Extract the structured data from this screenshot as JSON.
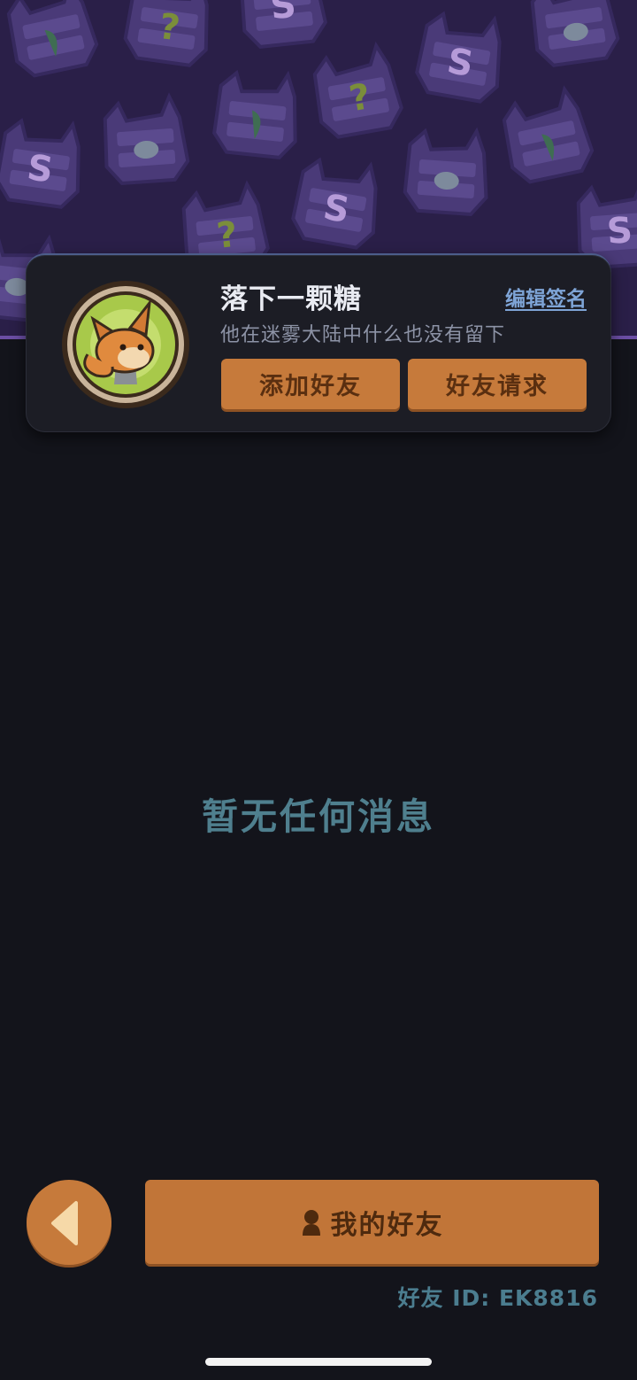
{
  "profile": {
    "nickname": "落下一颗糖",
    "edit_signature_label": "编辑签名",
    "signature": "他在迷雾大陆中什么也没有留下",
    "add_friend_label": "添加好友",
    "friend_request_label": "好友请求"
  },
  "messages": {
    "empty_text": "暂无任何消息"
  },
  "footer": {
    "my_friends_label": "我的好友",
    "friend_id": "好友 ID: EK8816"
  },
  "icons": {
    "back": "back-arrow-icon",
    "friends": "person-icon",
    "avatar": "fox-avatar"
  },
  "colors": {
    "background": "#13141b",
    "banner": "#2a1f48",
    "button": "#c67a3b",
    "button_text": "#5a2f10",
    "link": "#7ea4d6",
    "muted_teal": "#4f7f8e"
  }
}
